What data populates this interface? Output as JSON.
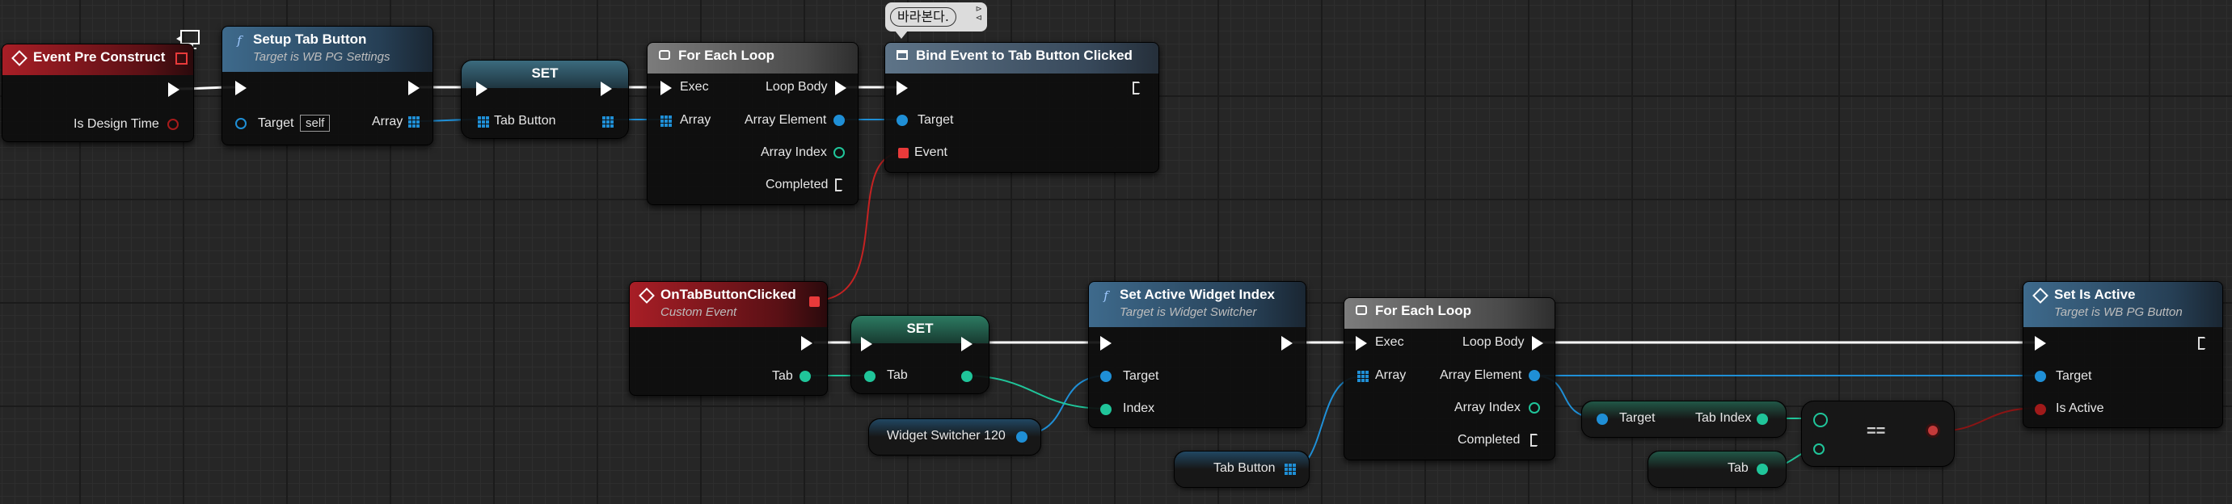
{
  "nodes": {
    "event_pre_construct": {
      "title": "Event Pre Construct",
      "is_design_time": "Is Design Time"
    },
    "setup_tab_button": {
      "title": "Setup Tab Button",
      "subtitle": "Target is WB PG Settings",
      "target": "Target",
      "self": "self",
      "array": "Array"
    },
    "set_1": {
      "title": "SET",
      "tab_button": "Tab Button"
    },
    "for_each_1": {
      "title": "For Each Loop",
      "exec": "Exec",
      "array": "Array",
      "loop_body": "Loop Body",
      "array_element": "Array Element",
      "array_index": "Array Index",
      "completed": "Completed"
    },
    "bind_event": {
      "title": "Bind Event to Tab Button Clicked",
      "target": "Target",
      "event": "Event",
      "comment": "바라본다."
    },
    "on_tab_clicked": {
      "title": "OnTabButtonClicked",
      "subtitle": "Custom Event",
      "tab": "Tab"
    },
    "set_2": {
      "title": "SET",
      "tab": "Tab"
    },
    "widget_switcher_var": {
      "label": "Widget Switcher 120"
    },
    "set_active_widget": {
      "title": "Set Active Widget Index",
      "subtitle": "Target is Widget Switcher",
      "target": "Target",
      "index": "Index"
    },
    "tab_button_var": {
      "label": "Tab Button"
    },
    "for_each_2": {
      "title": "For Each Loop",
      "exec": "Exec",
      "array": "Array",
      "loop_body": "Loop Body",
      "array_element": "Array Element",
      "array_index": "Array Index",
      "completed": "Completed"
    },
    "get_tab_index": {
      "target": "Target",
      "tab_index": "Tab Index"
    },
    "tab_var": {
      "label": "Tab"
    },
    "equal": {
      "op": "=="
    },
    "set_is_active": {
      "title": "Set Is Active",
      "subtitle": "Target is WB PG Button",
      "target": "Target",
      "is_active": "Is Active"
    }
  },
  "colors": {
    "exec": "#ffffff",
    "object_pin": "#1f8fd6",
    "int_pin": "#20c59a",
    "bool_pin": "#a01a1a",
    "delegate_pin": "#e83a3a",
    "event_header": "#a81e26",
    "function_header": "#3e6a8c",
    "macro_header": "#7c7c7c",
    "variable_header": "#2c6f5a"
  },
  "icons": [
    "event-diamond-icon",
    "function-icon",
    "loop-macro-icon",
    "bind-event-icon",
    "monitor-icon",
    "comment-pin-icon"
  ]
}
